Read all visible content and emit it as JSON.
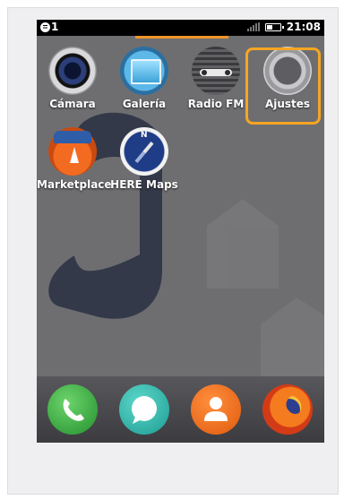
{
  "status_bar": {
    "time": "21:08",
    "notification_count": "1",
    "notification_icon": "notification-icon",
    "signal_icon": "signal-icon",
    "battery_icon": "battery-icon"
  },
  "apps": [
    {
      "label": "Cámara",
      "icon": "camera-icon"
    },
    {
      "label": "Galería",
      "icon": "gallery-icon"
    },
    {
      "label": "Radio FM",
      "icon": "radio-icon"
    },
    {
      "label": "Ajustes",
      "icon": "settings-gear-icon"
    },
    {
      "label": "Marketplace",
      "icon": "marketplace-icon"
    },
    {
      "label": "HERE Maps",
      "icon": "compass-icon"
    }
  ],
  "dock": [
    {
      "icon": "phone-icon"
    },
    {
      "icon": "messages-icon"
    },
    {
      "icon": "contacts-icon"
    },
    {
      "icon": "firefox-browser-icon"
    }
  ],
  "colors": {
    "highlight": "#f5a623",
    "page_indicator": "#f09426",
    "wallpaper": "#6d6d70"
  }
}
